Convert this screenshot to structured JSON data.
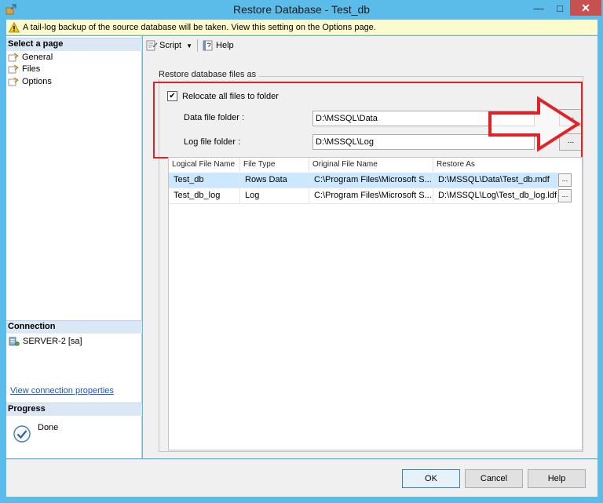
{
  "window": {
    "title": "Restore Database - Test_db",
    "minimize": "—",
    "maximize": "□",
    "close": "✕"
  },
  "warning": {
    "text": "A tail-log backup of the source database will be taken. View this setting on the Options page."
  },
  "sidebar": {
    "select_page_title": "Select a page",
    "pages": [
      {
        "label": "General"
      },
      {
        "label": "Files"
      },
      {
        "label": "Options"
      }
    ],
    "connection_title": "Connection",
    "connection_server": "SERVER-2 [sa]",
    "connection_link": "View connection properties",
    "progress_title": "Progress",
    "progress_status": "Done"
  },
  "toolbar": {
    "script_label": "Script",
    "help_label": "Help"
  },
  "files": {
    "group_label": "Restore database files as",
    "relocate_label": "Relocate all files to folder",
    "relocate_checked": true,
    "checkmark": "✔",
    "data_folder_label": "Data file folder :",
    "data_folder_value": "D:\\MSSQL\\Data",
    "log_folder_label": "Log file folder :",
    "log_folder_value": "D:\\MSSQL\\Log",
    "browse_label": "..."
  },
  "grid": {
    "columns": [
      "Logical File Name",
      "File Type",
      "Original File Name",
      "Restore As"
    ],
    "rows": [
      {
        "logical": "Test_db",
        "type": "Rows Data",
        "original": "C:\\Program Files\\Microsoft S...",
        "restore_as": "D:\\MSSQL\\Data\\Test_db.mdf",
        "btn": "..."
      },
      {
        "logical": "Test_db_log",
        "type": "Log",
        "original": "C:\\Program Files\\Microsoft S...",
        "restore_as": "D:\\MSSQL\\Log\\Test_db_log.ldf",
        "btn": "..."
      }
    ]
  },
  "footer": {
    "ok_label": "OK",
    "cancel_label": "Cancel",
    "help_label": "Help"
  },
  "colors": {
    "titlebar": "#5bbbe9",
    "annotation_red": "#e32227",
    "selected_row": "#cce8ff"
  }
}
